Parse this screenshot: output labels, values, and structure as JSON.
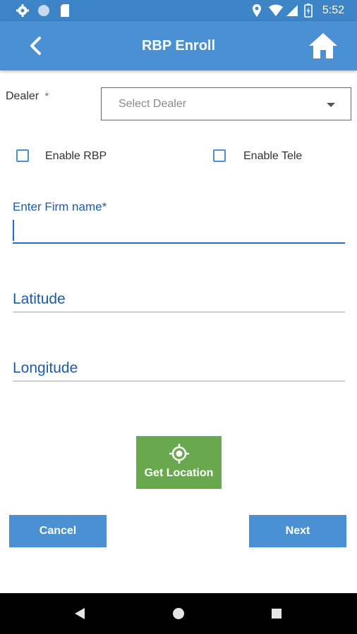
{
  "status_bar": {
    "time": "5:52"
  },
  "app_bar": {
    "title": "RBP Enroll"
  },
  "form": {
    "dealer_label": "Dealer",
    "required_mark": "*",
    "dealer_placeholder": "Select Dealer",
    "enable_rbp_label": "Enable RBP",
    "enable_tele_label": "Enable Tele",
    "firm_name_label": "Enter Firm name*",
    "firm_name_value": "",
    "latitude_label": "Latitude",
    "longitude_label": "Longitude"
  },
  "actions": {
    "get_location_label": "Get Location",
    "cancel_label": "Cancel",
    "next_label": "Next"
  }
}
